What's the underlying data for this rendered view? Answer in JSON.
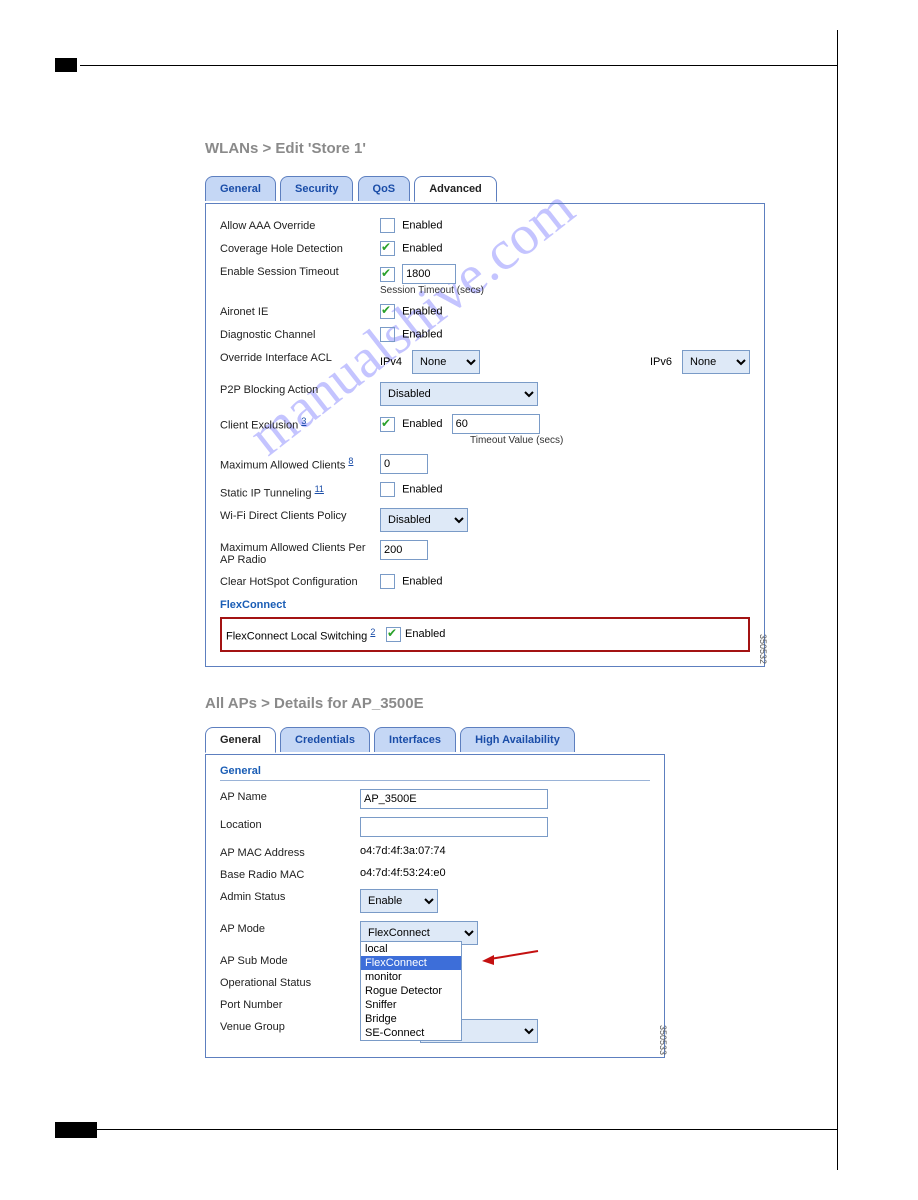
{
  "watermark": "manualshive.com",
  "section1": {
    "breadcrumb": "WLANs > Edit  'Store 1'",
    "tabs": [
      "General",
      "Security",
      "QoS",
      "Advanced"
    ],
    "active_tab": "Advanced",
    "rows": {
      "aaa_override": {
        "label": "Allow AAA Override",
        "checkbox_label": "Enabled",
        "checked": false
      },
      "chd": {
        "label": "Coverage Hole Detection",
        "checkbox_label": "Enabled",
        "checked": true
      },
      "session_timeout": {
        "label": "Enable Session Timeout",
        "checked": true,
        "value": "1800",
        "hint": "Session Timeout (secs)"
      },
      "aironet": {
        "label": "Aironet IE",
        "checkbox_label": "Enabled",
        "checked": true
      },
      "diag": {
        "label": "Diagnostic Channel",
        "checkbox_label": "Enabled",
        "checked": false
      },
      "oi_acl": {
        "label": "Override Interface ACL",
        "ipv4_label": "IPv4",
        "ipv4_value": "None",
        "ipv6_label": "IPv6",
        "ipv6_value": "None"
      },
      "p2p": {
        "label": "P2P Blocking Action",
        "value": "Disabled"
      },
      "client_excl": {
        "label": "Client Exclusion",
        "sup": "3",
        "checked": true,
        "checkbox_label": "Enabled",
        "value": "60",
        "hint": "Timeout Value (secs)"
      },
      "max_clients": {
        "label": "Maximum Allowed Clients",
        "sup": "8",
        "value": "0"
      },
      "static_ip": {
        "label": "Static IP Tunneling",
        "sup": "11",
        "checkbox_label": "Enabled",
        "checked": false
      },
      "wifi_direct": {
        "label": "Wi-Fi Direct Clients Policy",
        "value": "Disabled"
      },
      "max_per_radio": {
        "label": "Maximum Allowed Clients Per AP Radio",
        "value": "200"
      },
      "hotspot": {
        "label": "Clear HotSpot Configuration",
        "checkbox_label": "Enabled",
        "checked": false
      }
    },
    "flexconnect": {
      "heading": "FlexConnect",
      "label": "FlexConnect Local Switching",
      "sup": "2",
      "checkbox_label": "Enabled",
      "checked": true
    },
    "side_num": "350532"
  },
  "section2": {
    "breadcrumb": "All APs > Details for AP_3500E",
    "tabs": [
      "General",
      "Credentials",
      "Interfaces",
      "High Availability"
    ],
    "active_tab": "General",
    "group_title": "General",
    "rows": {
      "ap_name": {
        "label": "AP Name",
        "value": "AP_3500E"
      },
      "location": {
        "label": "Location",
        "value": ""
      },
      "mac": {
        "label": "AP MAC Address",
        "value": "o4:7d:4f:3a:07:74"
      },
      "base_mac": {
        "label": "Base Radio MAC",
        "value": "o4:7d:4f:53:24:e0"
      },
      "admin": {
        "label": "Admin Status",
        "value": "Enable"
      },
      "ap_mode": {
        "label": "AP Mode",
        "value": "FlexConnect",
        "options": [
          "local",
          "FlexConnect",
          "monitor",
          "Rogue Detector",
          "Sniffer",
          "Bridge",
          "SE-Connect"
        ]
      },
      "sub_mode": {
        "label": "AP Sub Mode"
      },
      "op_status": {
        "label": "Operational Status"
      },
      "port": {
        "label": "Port Number"
      },
      "venue": {
        "label": "Venue Group"
      }
    },
    "side_num": "350533"
  }
}
